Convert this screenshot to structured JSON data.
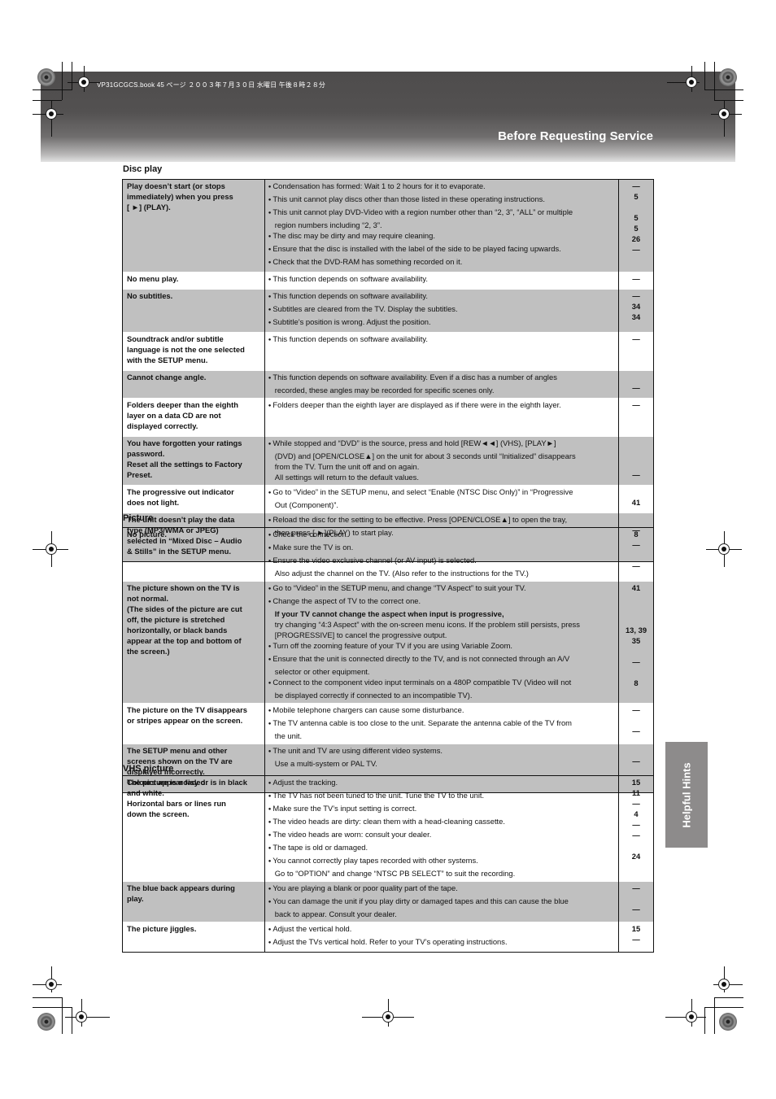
{
  "header": {
    "file_info": "VP31GCGCS.book  45 ページ  ２００３年７月３０日  水曜日  午後８時２８分",
    "page_title": "Before Requesting Service"
  },
  "side_tab": {
    "label": "Helpful Hints"
  },
  "sections": {
    "disc_play": {
      "title": "Disc play",
      "rows": [
        {
          "symptom": [
            "Play doesn’t start (or stops",
            "immediately) when you press",
            "[ ►] (PLAY)."
          ],
          "solutions": [
            {
              "text": "Condensation has formed: Wait 1 to 2 hours for it to evaporate.",
              "bullet": true,
              "ref": "—"
            },
            {
              "text": "This unit cannot play discs other than those listed in these operating instructions.",
              "bullet": true,
              "ref": "5"
            },
            {
              "text": "This unit cannot play DVD-Video with a region number other than “2, 3”, “ALL” or multiple",
              "bullet": true,
              "ref": ""
            },
            {
              "text": "region numbers including “2, 3”.",
              "bullet": false,
              "ref": "5"
            },
            {
              "text": "The disc may be dirty and may require cleaning.",
              "bullet": true,
              "ref": "5"
            },
            {
              "text": "Ensure that the disc is installed with the label of the side to be played facing upwards.",
              "bullet": true,
              "ref": "26"
            },
            {
              "text": "Check that the DVD-RAM has something recorded on it.",
              "bullet": true,
              "ref": "—"
            }
          ]
        },
        {
          "symptom": [
            "No menu play."
          ],
          "solutions": [
            {
              "text": "This function depends on software availability.",
              "bullet": true,
              "ref": "—"
            }
          ]
        },
        {
          "symptom": [
            "No subtitles."
          ],
          "solutions": [
            {
              "text": "This function depends on software availability.",
              "bullet": true,
              "ref": "—"
            },
            {
              "text": "Subtitles are cleared from the TV. Display the subtitles.",
              "bullet": true,
              "ref": "34"
            },
            {
              "text": "Subtitle’s position is wrong. Adjust the position.",
              "bullet": true,
              "ref": "34"
            }
          ]
        },
        {
          "symptom": [
            "Soundtrack and/or subtitle",
            "language is not the one selected",
            "with the SETUP menu."
          ],
          "solutions": [
            {
              "text": "This function depends on software availability.",
              "bullet": true,
              "ref": "—"
            },
            {
              "text": "",
              "bullet": false,
              "ref": ""
            },
            {
              "text": "",
              "bullet": false,
              "ref": ""
            }
          ]
        },
        {
          "symptom": [
            "Cannot change angle."
          ],
          "solutions": [
            {
              "text": "This function depends on software availability. Even if a disc has a number of angles",
              "bullet": true,
              "ref": ""
            },
            {
              "text": "recorded, these angles may be recorded for specific scenes only.",
              "bullet": false,
              "ref": "—"
            }
          ]
        },
        {
          "symptom": [
            "Folders deeper than the eighth",
            "layer on a data CD are not",
            "displayed correctly."
          ],
          "solutions": [
            {
              "text": "Folders deeper than the eighth layer are displayed as if there were in the eighth layer.",
              "bullet": true,
              "ref": "—"
            },
            {
              "text": "",
              "bullet": false,
              "ref": ""
            },
            {
              "text": "",
              "bullet": false,
              "ref": ""
            }
          ]
        },
        {
          "symptom": [
            "You have forgotten your ratings",
            "password.",
            "Reset all the settings to Factory",
            "Preset."
          ],
          "solutions": [
            {
              "text": "While stopped and “DVD” is the source, press and hold [REW◄◄] (VHS), [PLAY►]",
              "bullet": true,
              "ref": ""
            },
            {
              "text": "(DVD) and [OPEN/CLOSE▲] on the unit for about 3 seconds until “Initialized” disappears",
              "bullet": false,
              "ref": ""
            },
            {
              "text": "from the TV. Turn the unit off and on again.",
              "bullet": false,
              "ref": ""
            },
            {
              "text": "All settings will return to the default values.",
              "bullet": false,
              "ref": "—"
            }
          ]
        },
        {
          "symptom": [
            "The progressive out indicator",
            "does not light."
          ],
          "solutions": [
            {
              "text": "Go to “Video” in the SETUP menu, and select “Enable (NTSC Disc Only)” in “Progressive",
              "bullet": true,
              "ref": ""
            },
            {
              "text": "Out (Component)”.",
              "bullet": false,
              "ref": "41"
            }
          ]
        },
        {
          "symptom": [
            "The unit doesn’t play the data",
            "type (MP3/WMA or JPEG)",
            "selected in “Mixed Disc – Audio",
            "& Stills” in the SETUP menu."
          ],
          "solutions": [
            {
              "text": "Reload the disc for the setting to be effective. Press [OPEN/CLOSE▲] to open the tray,",
              "bullet": true,
              "ref": ""
            },
            {
              "text": "then press [ ►](PLAY) to start play.",
              "bullet": false,
              "ref": "—"
            },
            {
              "text": "",
              "bullet": false,
              "ref": ""
            },
            {
              "text": "",
              "bullet": false,
              "ref": ""
            }
          ]
        }
      ]
    },
    "picture": {
      "title": "Picture",
      "rows": [
        {
          "symptom": [
            "No picture."
          ],
          "solutions": [
            {
              "text": "Check the connection.",
              "bullet": true,
              "ref": "8"
            },
            {
              "text": "Make sure the TV is on.",
              "bullet": true,
              "ref": "—"
            },
            {
              "text": "Ensure the video exclusive channel (or AV input) is selected.",
              "bullet": true,
              "ref": ""
            },
            {
              "text": "Also adjust the channel on the TV. (Also refer to the instructions for the TV.)",
              "bullet": false,
              "ref": "—"
            }
          ]
        },
        {
          "symptom": [
            "The picture shown on the TV is",
            "not normal.",
            "(The sides of the picture are cut",
            "off, the picture is stretched",
            "horizontally, or black bands",
            "appear at the top and bottom of",
            "the screen.)"
          ],
          "solutions": [
            {
              "text": "Go to “Video” in the SETUP menu, and change “TV Aspect” to suit your TV.",
              "bullet": true,
              "ref": "41"
            },
            {
              "text": "Change the aspect of TV to the correct one.",
              "bullet": true,
              "ref": ""
            },
            {
              "text": "If your TV cannot change the aspect when input is progressive,",
              "bullet": false,
              "bold": true,
              "ref": ""
            },
            {
              "text": "try changing “4:3 Aspect” with the on-screen menu icons. If the problem still persists, press",
              "bullet": false,
              "ref": ""
            },
            {
              "text": "[PROGRESSIVE] to cancel the progressive output.",
              "bullet": false,
              "ref": "13, 39"
            },
            {
              "text": "Turn off the zooming feature of your TV if you are using Variable Zoom.",
              "bullet": true,
              "ref": "35"
            },
            {
              "text": "Ensure that the unit is connected directly to the TV, and is not connected through an A/V",
              "bullet": true,
              "ref": ""
            },
            {
              "text": "selector or other equipment.",
              "bullet": false,
              "ref": "—"
            },
            {
              "text": "Connect to the component video input terminals on a 480P compatible TV (Video will not",
              "bullet": true,
              "ref": ""
            },
            {
              "text": "be displayed correctly if connected to an incompatible TV).",
              "bullet": false,
              "ref": "8"
            }
          ]
        },
        {
          "symptom": [
            "The picture on the TV disappears",
            "or stripes appear on the screen."
          ],
          "solutions": [
            {
              "text": "Mobile telephone chargers can cause some disturbance.",
              "bullet": true,
              "ref": "—"
            },
            {
              "text": "The TV antenna cable is too close to the unit. Separate the antenna cable of the TV from",
              "bullet": true,
              "ref": ""
            },
            {
              "text": "the unit.",
              "bullet": false,
              "ref": "—"
            }
          ]
        },
        {
          "symptom": [
            "The SETUP menu and other",
            "screens shown on the TV are",
            "displayed incorrectly.",
            "Colours appear faded."
          ],
          "solutions": [
            {
              "text": "The unit and TV are using different video systems.",
              "bullet": true,
              "ref": ""
            },
            {
              "text": "Use a multi-system or PAL TV.",
              "bullet": false,
              "ref": "—"
            },
            {
              "text": "",
              "bullet": false,
              "ref": ""
            },
            {
              "text": "",
              "bullet": false,
              "ref": ""
            }
          ]
        }
      ]
    },
    "vhs_picture": {
      "title": "VHS picture",
      "rows": [
        {
          "symptom": [
            "The picture is noisy or is in black",
            "and white.",
            "Horizontal bars or lines run",
            "down the screen."
          ],
          "solutions": [
            {
              "text": "Adjust the tracking.",
              "bullet": true,
              "ref": "15"
            },
            {
              "text": "The TV has not been tuned to the unit. Tune the TV to the unit.",
              "bullet": true,
              "ref": "11"
            },
            {
              "text": "Make sure the TV’s input setting is correct.",
              "bullet": true,
              "ref": "—"
            },
            {
              "text": "The video heads are dirty: clean them with a head-cleaning cassette.",
              "bullet": true,
              "ref": "4"
            },
            {
              "text": "The video heads are worn: consult your dealer.",
              "bullet": true,
              "ref": "—"
            },
            {
              "text": "The tape is old or damaged.",
              "bullet": true,
              "ref": "—"
            },
            {
              "text": "You cannot correctly play tapes recorded with other systems.",
              "bullet": true,
              "ref": ""
            },
            {
              "text": "Go to “OPTION” and change “NTSC PB SELECT” to suit the recording.",
              "bullet": false,
              "ref": "24"
            }
          ]
        },
        {
          "symptom": [
            "The blue back appears during",
            "play."
          ],
          "solutions": [
            {
              "text": "You are playing a blank or poor quality part of the tape.",
              "bullet": true,
              "ref": "—"
            },
            {
              "text": "You can damage the unit if you play dirty or damaged tapes and this can cause the blue",
              "bullet": true,
              "ref": ""
            },
            {
              "text": "back to appear. Consult your dealer.",
              "bullet": false,
              "ref": "—"
            }
          ]
        },
        {
          "symptom": [
            "The picture jiggles."
          ],
          "solutions": [
            {
              "text": "Adjust the vertical hold.",
              "bullet": true,
              "ref": "15"
            },
            {
              "text": "Adjust the TVs vertical hold. Refer to your TV’s operating instructions.",
              "bullet": true,
              "ref": "—"
            }
          ]
        }
      ]
    }
  }
}
